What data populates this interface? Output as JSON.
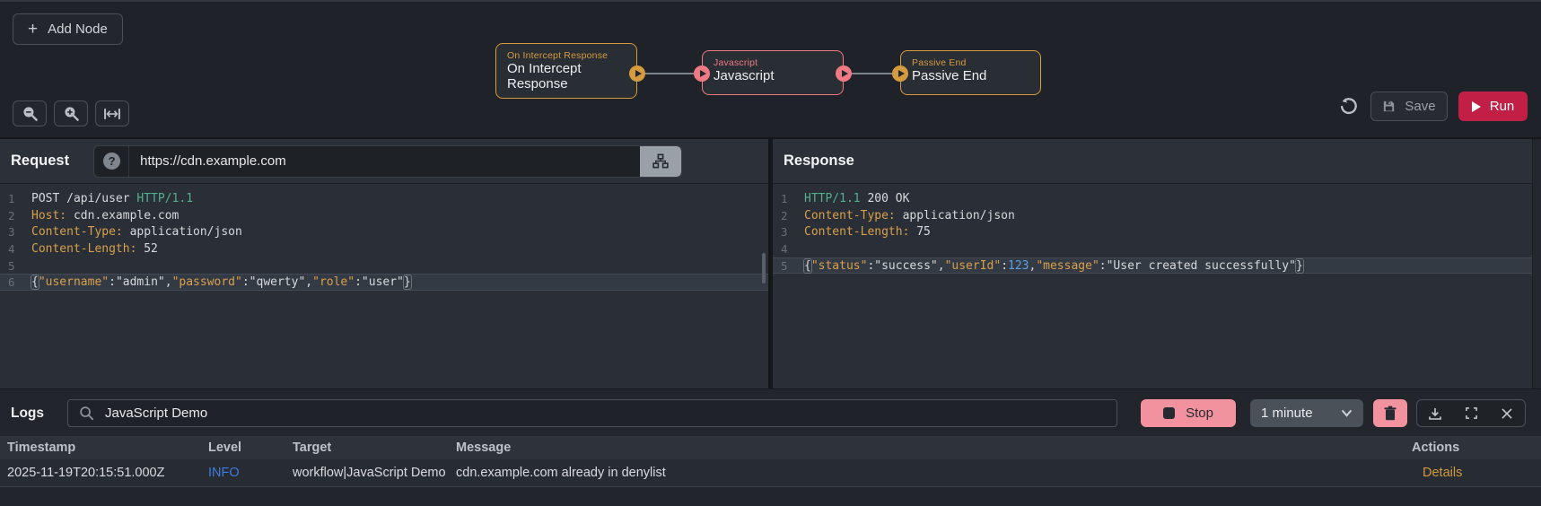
{
  "accents": {
    "node_orange": "#d79b3f",
    "node_red": "#f07a84",
    "run_button_bg": "#c21f47",
    "pink_button_bg": "#f2929f",
    "info_level_blue": "#3e7de0",
    "details_link_orange": "#d19a3f",
    "syntax_key_orange": "#d7a04d",
    "syntax_green": "#53b08d",
    "syntax_number_blue": "#5ba0e6"
  },
  "workflow": {
    "add_node_button": "Add Node",
    "nodes": [
      {
        "type_label": "On Intercept Response",
        "title": "On Intercept Response",
        "color": "orange"
      },
      {
        "type_label": "Javascript",
        "title": "Javascript",
        "color": "red"
      },
      {
        "type_label": "Passive End",
        "title": "Passive End",
        "color": "orange"
      }
    ],
    "toolbar_icons": [
      "zoom-out-icon",
      "zoom-in-icon",
      "fit-width-icon"
    ],
    "actions": {
      "undo_icon": "undo-icon",
      "save": "Save",
      "run": "Run"
    }
  },
  "request": {
    "title": "Request",
    "url": "https://cdn.example.com",
    "icons": [
      "help-icon",
      "sitemap-icon"
    ],
    "lines": [
      {
        "n": "1",
        "tokens": [
          {
            "t": "POST /api/user ",
            "c": "plain"
          },
          {
            "t": "HTTP/1.1",
            "c": "green"
          }
        ]
      },
      {
        "n": "2",
        "tokens": [
          {
            "t": "Host:",
            "c": "key"
          },
          {
            "t": " cdn.example.com",
            "c": "plain"
          }
        ]
      },
      {
        "n": "3",
        "tokens": [
          {
            "t": "Content-Type:",
            "c": "key"
          },
          {
            "t": " application/json",
            "c": "plain"
          }
        ]
      },
      {
        "n": "4",
        "tokens": [
          {
            "t": "Content-Length:",
            "c": "key"
          },
          {
            "t": " 52",
            "c": "plain"
          }
        ]
      },
      {
        "n": "5",
        "tokens": []
      },
      {
        "n": "6",
        "hl": true,
        "tokens": [
          {
            "t": "{",
            "c": "bracket"
          },
          {
            "t": "\"username\"",
            "c": "key"
          },
          {
            "t": ":",
            "c": "plain"
          },
          {
            "t": "\"admin\"",
            "c": "plain"
          },
          {
            "t": ",",
            "c": "plain"
          },
          {
            "t": "\"password\"",
            "c": "key"
          },
          {
            "t": ":",
            "c": "plain"
          },
          {
            "t": "\"qwerty\"",
            "c": "plain"
          },
          {
            "t": ",",
            "c": "plain"
          },
          {
            "t": "\"role\"",
            "c": "key"
          },
          {
            "t": ":",
            "c": "plain"
          },
          {
            "t": "\"user\"",
            "c": "plain"
          },
          {
            "t": "}",
            "c": "bracket"
          }
        ]
      }
    ]
  },
  "response": {
    "title": "Response",
    "lines": [
      {
        "n": "1",
        "tokens": [
          {
            "t": "HTTP/1.1",
            "c": "green"
          },
          {
            "t": " 200 OK",
            "c": "plain"
          }
        ]
      },
      {
        "n": "2",
        "tokens": [
          {
            "t": "Content-Type:",
            "c": "key"
          },
          {
            "t": " application/json",
            "c": "plain"
          }
        ]
      },
      {
        "n": "3",
        "tokens": [
          {
            "t": "Content-Length:",
            "c": "key"
          },
          {
            "t": " 75",
            "c": "plain"
          }
        ]
      },
      {
        "n": "4",
        "tokens": []
      },
      {
        "n": "5",
        "hl": true,
        "tokens": [
          {
            "t": "{",
            "c": "bracket"
          },
          {
            "t": "\"status\"",
            "c": "key"
          },
          {
            "t": ":",
            "c": "plain"
          },
          {
            "t": "\"success\"",
            "c": "plain"
          },
          {
            "t": ",",
            "c": "plain"
          },
          {
            "t": "\"userId\"",
            "c": "key"
          },
          {
            "t": ":",
            "c": "plain"
          },
          {
            "t": "123",
            "c": "blue"
          },
          {
            "t": ",",
            "c": "plain"
          },
          {
            "t": "\"message\"",
            "c": "key"
          },
          {
            "t": ":",
            "c": "plain"
          },
          {
            "t": "\"User created successfully\"",
            "c": "plain"
          },
          {
            "t": "}",
            "c": "bracket"
          }
        ]
      }
    ]
  },
  "logs": {
    "title": "Logs",
    "search_value": "JavaScript Demo",
    "search_icon": "search-icon",
    "stop_button": "Stop",
    "interval_select": "1 minute",
    "icons": [
      "trash-icon",
      "download-icon",
      "expand-icon",
      "close-icon"
    ],
    "table": {
      "headers": [
        "Timestamp",
        "Level",
        "Target",
        "Message",
        "Actions"
      ],
      "rows": [
        {
          "timestamp": "2025-11-19T20:15:51.000Z",
          "level": "INFO",
          "target": "workflow|JavaScript Demo",
          "message": "cdn.example.com already in denylist",
          "action": "Details"
        }
      ]
    }
  }
}
